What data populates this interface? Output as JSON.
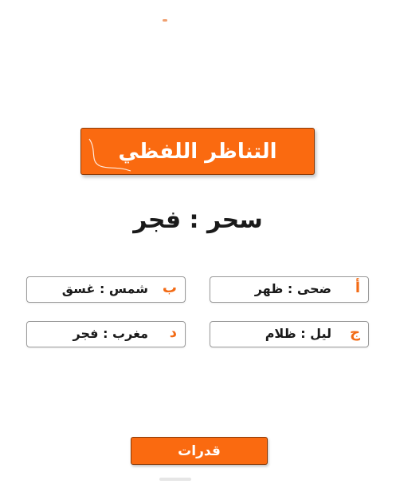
{
  "title": "التناظر اللفظي",
  "question": "سحر : فجر",
  "options": [
    {
      "letter": "أ",
      "text": "ضحى : ظهر"
    },
    {
      "letter": "ب",
      "text": "شمس : غسق"
    },
    {
      "letter": "ج",
      "text": "ليل : ظلام"
    },
    {
      "letter": "د",
      "text": "مغرب : فجر"
    }
  ],
  "category_button": "قدرات",
  "colors": {
    "accent": "#fa6a10",
    "letter": "#f26a14",
    "text": "#1a1a1a",
    "border": "#9a9a9a"
  },
  "icons": {
    "decoration": "curl-decoration-icon"
  }
}
